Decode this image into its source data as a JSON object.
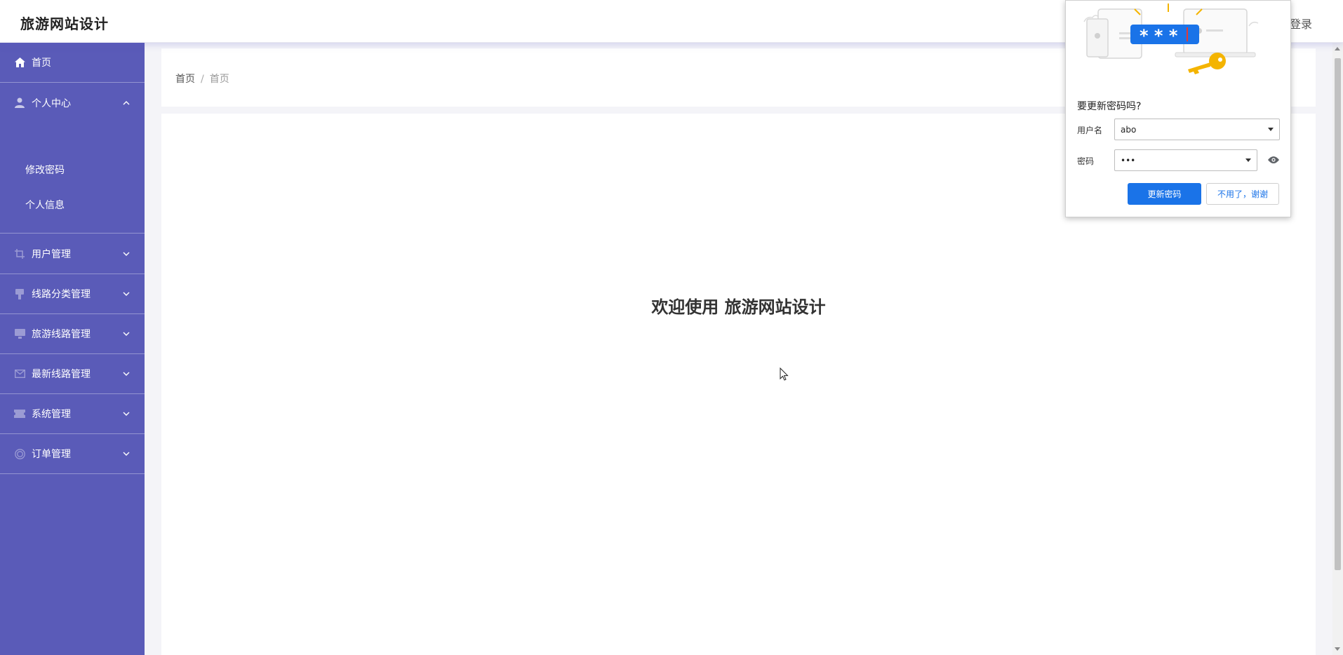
{
  "header": {
    "brand": "旅游网站设计",
    "login": "登录"
  },
  "sidebar": {
    "items": [
      {
        "label": "首页",
        "icon": "home-icon"
      },
      {
        "label": "个人中心",
        "icon": "user-icon",
        "expanded": true
      },
      {
        "label": "用户管理",
        "icon": "crop-icon"
      },
      {
        "label": "线路分类管理",
        "icon": "brush-icon"
      },
      {
        "label": "旅游线路管理",
        "icon": "monitor-icon"
      },
      {
        "label": "最新线路管理",
        "icon": "mail-icon"
      },
      {
        "label": "系统管理",
        "icon": "ticket-icon"
      },
      {
        "label": "订单管理",
        "icon": "target-icon"
      }
    ],
    "sub_items": [
      {
        "label": "修改密码"
      },
      {
        "label": "个人信息"
      }
    ],
    "colors": {
      "background": "#5a5bb8",
      "text": "#ffffff"
    }
  },
  "breadcrumb": {
    "home": "首页",
    "separator": "/",
    "current": "首页"
  },
  "main": {
    "welcome": "欢迎使用 旅游网站设计"
  },
  "password_popup": {
    "title": "要更新密码吗?",
    "username_label": "用户名",
    "username_value": "abo",
    "password_label": "密码",
    "password_value": "•••",
    "update_button": "更新密码",
    "decline_button": "不用了，谢谢",
    "illustration_text": "* * *",
    "colors": {
      "primary": "#1a73e8"
    }
  }
}
